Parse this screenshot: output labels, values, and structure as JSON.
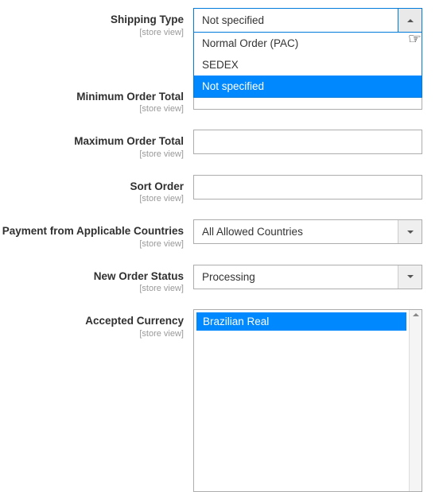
{
  "fields": {
    "scope_label": "[store view]",
    "shipping_type": {
      "label": "Shipping Type",
      "value": "Not specified",
      "options": [
        "Normal Order (PAC)",
        "SEDEX",
        "Not specified"
      ]
    },
    "min_total": {
      "label": "Minimum Order Total",
      "value": ""
    },
    "max_total": {
      "label": "Maximum Order Total",
      "value": ""
    },
    "sort_order": {
      "label": "Sort Order",
      "value": ""
    },
    "countries": {
      "label": "Payment from Applicable Countries",
      "value": "All Allowed Countries"
    },
    "new_order_status": {
      "label": "New Order Status",
      "value": "Processing"
    },
    "currency": {
      "label": "Accepted Currency",
      "options": [
        "Brazilian Real"
      ]
    }
  }
}
